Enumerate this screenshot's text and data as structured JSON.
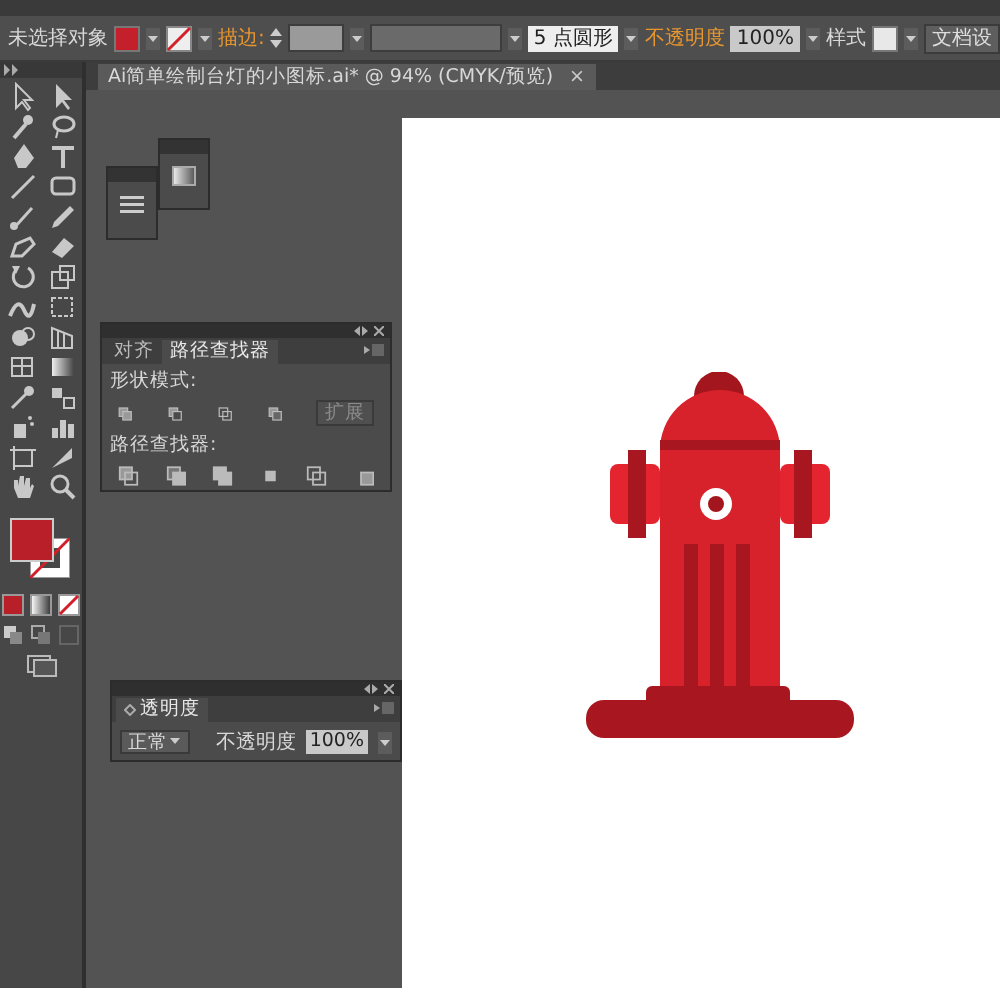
{
  "control_bar": {
    "selection_status": "未选择对象",
    "stroke_label": "描边:",
    "brush": "5 点圆形",
    "opacity_label": "不透明度",
    "opacity": "100%",
    "style_label": "样式",
    "document_button": "文档设"
  },
  "document_tab": {
    "title": "Ai简单绘制台灯的小图标.ai* @ 94% (CMYK/预览)",
    "close": "×"
  },
  "pathfinder_panel": {
    "tabs": [
      {
        "label": "对齐",
        "selected": false
      },
      {
        "label": "路径查找器",
        "selected": true
      }
    ],
    "shape_modes_label": "形状模式:",
    "expand_button": {
      "label": "扩展",
      "disabled": true
    },
    "pathfinders_label": "路径查找器:"
  },
  "transparency_panel": {
    "tab": "透明度",
    "blend_mode": "正常",
    "opacity_label": "不透明度",
    "opacity": "100%"
  }
}
